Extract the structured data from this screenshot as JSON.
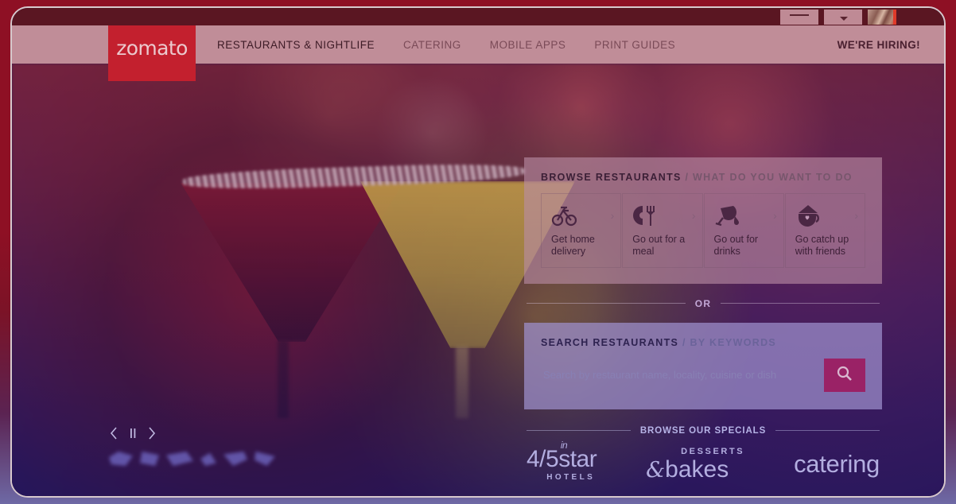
{
  "brand": {
    "logo_text": "zomato",
    "logo_bg": "#c3202e"
  },
  "topbar": {
    "login_label": "",
    "signup_label": "",
    "flag_label": ""
  },
  "nav": {
    "items": [
      {
        "label": "RESTAURANTS & NIGHTLIFE",
        "active": true
      },
      {
        "label": "CATERING",
        "active": false
      },
      {
        "label": "MOBILE APPS",
        "active": false
      },
      {
        "label": "PRINT GUIDES",
        "active": false
      }
    ],
    "hiring_label": "WE'RE HIRING!"
  },
  "browse": {
    "title": "BROWSE RESTAURANTS",
    "subtitle": "/ WHAT DO YOU WANT TO DO",
    "tiles": [
      {
        "label": "Get home delivery",
        "icon": "bicycle-icon",
        "chevron": "›"
      },
      {
        "label": "Go out for a meal",
        "icon": "cutlery-icon",
        "chevron": "›"
      },
      {
        "label": "Go out for drinks",
        "icon": "wine-glass-icon",
        "chevron": "›"
      },
      {
        "label": "Go catch up with friends",
        "icon": "coffee-cup-heart-icon",
        "chevron": "›"
      }
    ]
  },
  "divider": {
    "or_label": "OR"
  },
  "search": {
    "title": "SEARCH RESTAURANTS",
    "subtitle": "/ BY KEYWORDS",
    "placeholder": "Search by restaurant name, locality, cuisine or dish",
    "value": "",
    "button_icon": "search-icon",
    "button_color": "#9a2266"
  },
  "specials": {
    "heading": "BROWSE OUR SPECIALS",
    "items": [
      {
        "id": "hotels",
        "sup": "in",
        "main": "4/5star",
        "sub": "HOTELS"
      },
      {
        "id": "desserts",
        "top": "DESSERTS",
        "amp": "&",
        "main": "bakes"
      },
      {
        "id": "catering",
        "main": "catering"
      }
    ]
  },
  "carousel": {
    "prev_icon": "chevron-left-icon",
    "pause_icon": "pause-icon",
    "next_icon": "chevron-right-icon",
    "thumbnail_count": 6
  },
  "hero": {
    "alt": "cocktail-glasses-photo"
  }
}
